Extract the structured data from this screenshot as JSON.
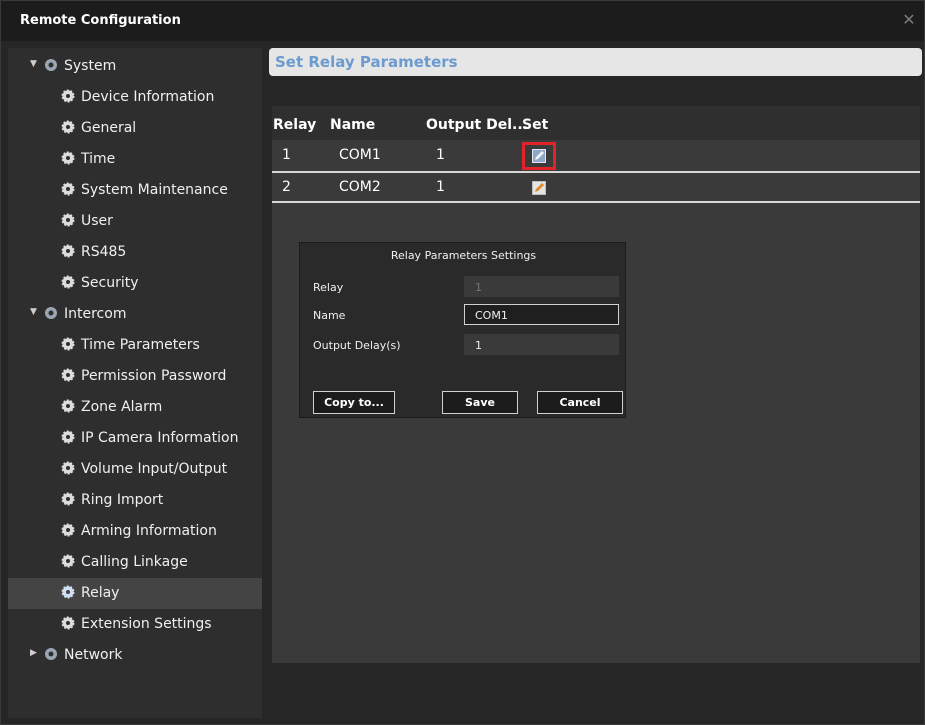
{
  "window": {
    "title": "Remote Configuration",
    "close_glyph": "✕"
  },
  "sidebar": {
    "groups": [
      {
        "label": "System",
        "expanded": true,
        "items": [
          "Device Information",
          "General",
          "Time",
          "System Maintenance",
          "User",
          "RS485",
          "Security"
        ]
      },
      {
        "label": "Intercom",
        "expanded": true,
        "items": [
          "Time Parameters",
          "Permission Password",
          "Zone Alarm",
          "IP Camera Information",
          "Volume Input/Output",
          "Ring Import",
          "Arming Information",
          "Calling Linkage",
          "Relay",
          "Extension Settings"
        ]
      },
      {
        "label": "Network",
        "expanded": false,
        "items": []
      }
    ],
    "selected": "Relay"
  },
  "section": {
    "title": "Set Relay Parameters"
  },
  "table": {
    "headers": [
      "Relay",
      "Name",
      "Output Del...",
      "Set"
    ],
    "rows": [
      {
        "relay": "1",
        "name": "COM1",
        "delay": "1"
      },
      {
        "relay": "2",
        "name": "COM2",
        "delay": "1"
      }
    ]
  },
  "dialog": {
    "title": "Relay Parameters Settings",
    "relay_label": "Relay",
    "relay_value": "1",
    "name_label": "Name",
    "name_value": "COM1",
    "delay_label": "Output Delay(s)",
    "delay_value": "1",
    "copy_label": "Copy to...",
    "save_label": "Save",
    "cancel_label": "Cancel"
  },
  "colors": {
    "accent": "#6c9bcf",
    "highlight": "#e0242a"
  }
}
